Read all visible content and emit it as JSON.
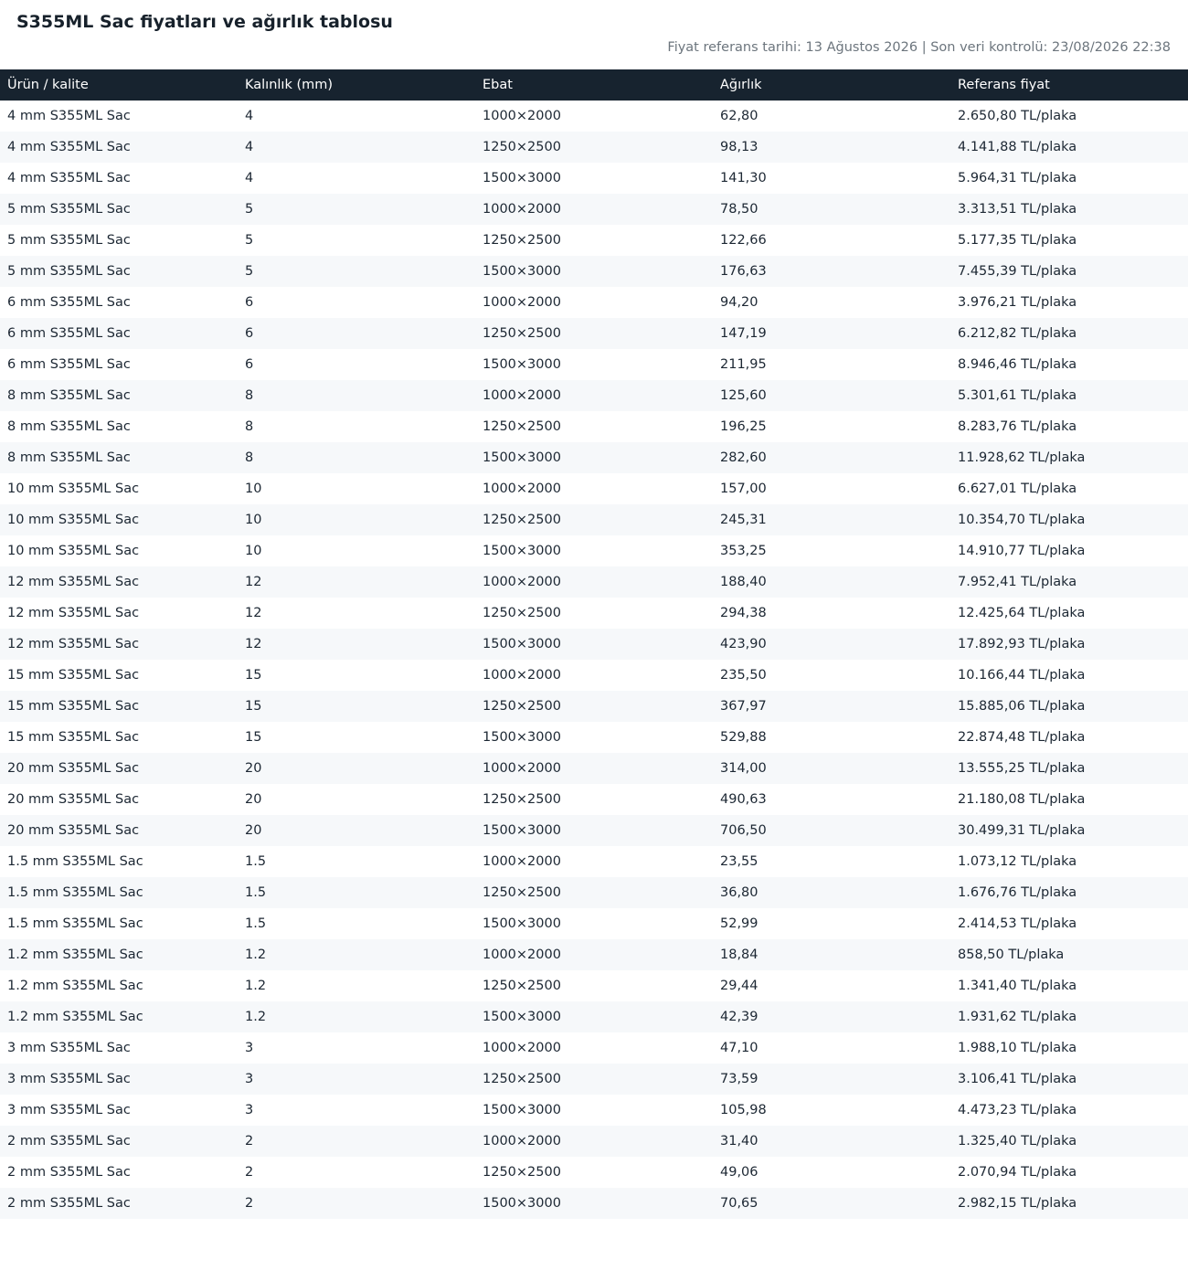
{
  "page": {
    "title": "S355ML Sac fiyatları ve ağırlık tablosu",
    "reference_line": "Fiyat referans tarihi: 13 Ağustos 2026 | Son veri kontrolü: 23/08/2026 22:38"
  },
  "table": {
    "headers": [
      "Ürün / kalite",
      "Kalınlık (mm)",
      "Ebat",
      "Ağırlık",
      "Referans fiyat"
    ],
    "rows": [
      [
        "4 mm S355ML Sac",
        "4",
        "1000×2000",
        "62,80",
        "2.650,80 TL/plaka"
      ],
      [
        "4 mm S355ML Sac",
        "4",
        "1250×2500",
        "98,13",
        "4.141,88 TL/plaka"
      ],
      [
        "4 mm S355ML Sac",
        "4",
        "1500×3000",
        "141,30",
        "5.964,31 TL/plaka"
      ],
      [
        "5 mm S355ML Sac",
        "5",
        "1000×2000",
        "78,50",
        "3.313,51 TL/plaka"
      ],
      [
        "5 mm S355ML Sac",
        "5",
        "1250×2500",
        "122,66",
        "5.177,35 TL/plaka"
      ],
      [
        "5 mm S355ML Sac",
        "5",
        "1500×3000",
        "176,63",
        "7.455,39 TL/plaka"
      ],
      [
        "6 mm S355ML Sac",
        "6",
        "1000×2000",
        "94,20",
        "3.976,21 TL/plaka"
      ],
      [
        "6 mm S355ML Sac",
        "6",
        "1250×2500",
        "147,19",
        "6.212,82 TL/plaka"
      ],
      [
        "6 mm S355ML Sac",
        "6",
        "1500×3000",
        "211,95",
        "8.946,46 TL/plaka"
      ],
      [
        "8 mm S355ML Sac",
        "8",
        "1000×2000",
        "125,60",
        "5.301,61 TL/plaka"
      ],
      [
        "8 mm S355ML Sac",
        "8",
        "1250×2500",
        "196,25",
        "8.283,76 TL/plaka"
      ],
      [
        "8 mm S355ML Sac",
        "8",
        "1500×3000",
        "282,60",
        "11.928,62 TL/plaka"
      ],
      [
        "10 mm S355ML Sac",
        "10",
        "1000×2000",
        "157,00",
        "6.627,01 TL/plaka"
      ],
      [
        "10 mm S355ML Sac",
        "10",
        "1250×2500",
        "245,31",
        "10.354,70 TL/plaka"
      ],
      [
        "10 mm S355ML Sac",
        "10",
        "1500×3000",
        "353,25",
        "14.910,77 TL/plaka"
      ],
      [
        "12 mm S355ML Sac",
        "12",
        "1000×2000",
        "188,40",
        "7.952,41 TL/plaka"
      ],
      [
        "12 mm S355ML Sac",
        "12",
        "1250×2500",
        "294,38",
        "12.425,64 TL/plaka"
      ],
      [
        "12 mm S355ML Sac",
        "12",
        "1500×3000",
        "423,90",
        "17.892,93 TL/plaka"
      ],
      [
        "15 mm S355ML Sac",
        "15",
        "1000×2000",
        "235,50",
        "10.166,44 TL/plaka"
      ],
      [
        "15 mm S355ML Sac",
        "15",
        "1250×2500",
        "367,97",
        "15.885,06 TL/plaka"
      ],
      [
        "15 mm S355ML Sac",
        "15",
        "1500×3000",
        "529,88",
        "22.874,48 TL/plaka"
      ],
      [
        "20 mm S355ML Sac",
        "20",
        "1000×2000",
        "314,00",
        "13.555,25 TL/plaka"
      ],
      [
        "20 mm S355ML Sac",
        "20",
        "1250×2500",
        "490,63",
        "21.180,08 TL/plaka"
      ],
      [
        "20 mm S355ML Sac",
        "20",
        "1500×3000",
        "706,50",
        "30.499,31 TL/plaka"
      ],
      [
        "1.5 mm S355ML Sac",
        "1.5",
        "1000×2000",
        "23,55",
        "1.073,12 TL/plaka"
      ],
      [
        "1.5 mm S355ML Sac",
        "1.5",
        "1250×2500",
        "36,80",
        "1.676,76 TL/plaka"
      ],
      [
        "1.5 mm S355ML Sac",
        "1.5",
        "1500×3000",
        "52,99",
        "2.414,53 TL/plaka"
      ],
      [
        "1.2 mm S355ML Sac",
        "1.2",
        "1000×2000",
        "18,84",
        "858,50 TL/plaka"
      ],
      [
        "1.2 mm S355ML Sac",
        "1.2",
        "1250×2500",
        "29,44",
        "1.341,40 TL/plaka"
      ],
      [
        "1.2 mm S355ML Sac",
        "1.2",
        "1500×3000",
        "42,39",
        "1.931,62 TL/plaka"
      ],
      [
        "3 mm S355ML Sac",
        "3",
        "1000×2000",
        "47,10",
        "1.988,10 TL/plaka"
      ],
      [
        "3 mm S355ML Sac",
        "3",
        "1250×2500",
        "73,59",
        "3.106,41 TL/plaka"
      ],
      [
        "3 mm S355ML Sac",
        "3",
        "1500×3000",
        "105,98",
        "4.473,23 TL/plaka"
      ],
      [
        "2 mm S355ML Sac",
        "2",
        "1000×2000",
        "31,40",
        "1.325,40 TL/plaka"
      ],
      [
        "2 mm S355ML Sac",
        "2",
        "1250×2500",
        "49,06",
        "2.070,94 TL/plaka"
      ],
      [
        "2 mm S355ML Sac",
        "2",
        "1500×3000",
        "70,65",
        "2.982,15 TL/plaka"
      ]
    ]
  }
}
